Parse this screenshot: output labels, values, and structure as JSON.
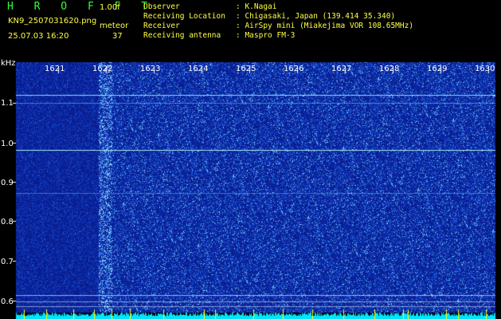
{
  "header": {
    "logo": "H R O F F T",
    "version": "1.00f",
    "filename": "KN9_2507031620.png",
    "datetime": "25.07.03 16:20",
    "meteor_label": "meteor",
    "meteor_count": "37",
    "info": [
      {
        "key": "Observer",
        "value": ": K.Nagai"
      },
      {
        "key": "Receiving Location",
        "value": ": Chigasaki, Japan (139.414 35.340)"
      },
      {
        "key": "Receiver",
        "value": ": AirSpy mini (Miakejima VOR 108.65MHz)"
      },
      {
        "key": "Receiving antenna",
        "value": ": Maspro FM-3"
      }
    ]
  },
  "axis": {
    "y_unit": "kHz",
    "y_ticks": [
      "1.1",
      "1.0",
      "0.9",
      "0.8",
      "0.7",
      "0.6"
    ],
    "x_ticks": [
      "1621",
      "1622",
      "1623",
      "1624",
      "1625",
      "1626",
      "1627",
      "1628",
      "1629",
      "1630"
    ]
  },
  "colors": {
    "background": "#000000",
    "waterfall_base": "#0a1f9e",
    "accent_green": "#33ff33",
    "header_yellow": "#ffff44",
    "bottom_bar": "#00e5ff",
    "marker_yellow": "#ffff00"
  }
}
